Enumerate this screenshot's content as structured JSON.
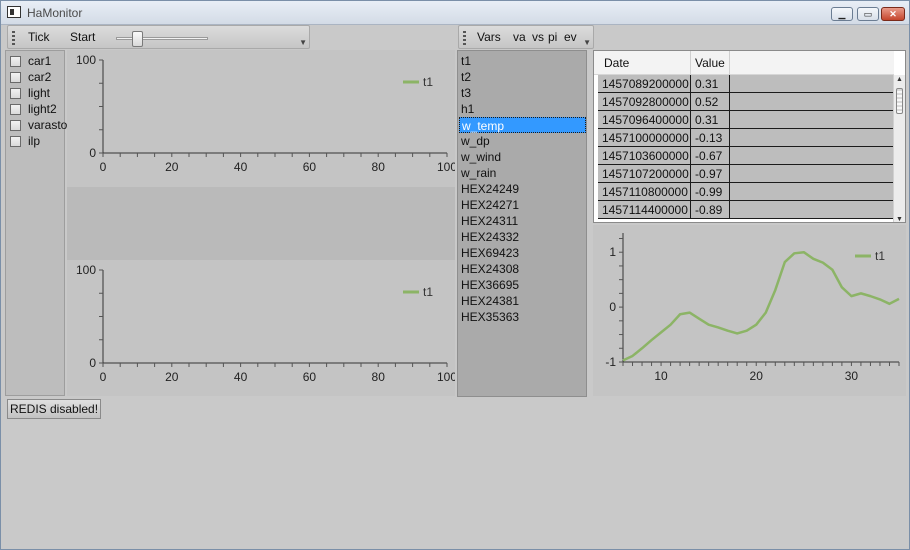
{
  "window": {
    "title": "HaMonitor",
    "controls": [
      "▁",
      "▭",
      "✕"
    ]
  },
  "toolbar1": {
    "items": [
      "Tick",
      "Start"
    ]
  },
  "toolbar2": {
    "items": [
      "Vars",
      "va",
      "vs",
      "pi",
      "ev"
    ]
  },
  "checkboxes": [
    {
      "label": "car1",
      "checked": false
    },
    {
      "label": "car2",
      "checked": false
    },
    {
      "label": "light",
      "checked": false
    },
    {
      "label": "light2",
      "checked": false
    },
    {
      "label": "varasto",
      "checked": false
    },
    {
      "label": "ilp",
      "checked": false
    }
  ],
  "vars": {
    "items": [
      "t1",
      "t2",
      "t3",
      "h1",
      "w_temp",
      "w_dp",
      "w_wind",
      "w_rain",
      "HEX24249",
      "HEX24271",
      "HEX24311",
      "HEX24332",
      "HEX69423",
      "HEX24308",
      "HEX36695",
      "HEX24381",
      "HEX35363"
    ],
    "selected": "w_temp"
  },
  "grid": {
    "columns": [
      "Date",
      "Value"
    ],
    "rows": [
      [
        "1457089200000",
        "0.31"
      ],
      [
        "1457092800000",
        "0.52"
      ],
      [
        "1457096400000",
        "0.31"
      ],
      [
        "1457100000000",
        "-0.13"
      ],
      [
        "1457103600000",
        "-0.67"
      ],
      [
        "1457107200000",
        "-0.97"
      ],
      [
        "1457110800000",
        "-0.99"
      ],
      [
        "1457114400000",
        "-0.89"
      ]
    ]
  },
  "status": {
    "label": "REDIS disabled!"
  },
  "colors": {
    "series": "#8cb466",
    "selection": "#3399ff"
  },
  "chart_data": [
    {
      "type": "line",
      "title": "",
      "xlabel": "",
      "ylabel": "",
      "xlim": [
        0,
        100
      ],
      "ylim": [
        0,
        100
      ],
      "xticks": [
        "0",
        "20",
        "40",
        "60",
        "80",
        "100"
      ],
      "yticks": [
        "0",
        "100"
      ],
      "legend": "top-right",
      "grid": false,
      "series": [
        {
          "name": "t1",
          "x": [],
          "y": []
        }
      ]
    },
    {
      "type": "line",
      "title": "",
      "xlabel": "",
      "ylabel": "",
      "xlim": [
        0,
        100
      ],
      "ylim": [
        0,
        100
      ],
      "xticks": [
        "0",
        "20",
        "40",
        "60",
        "80",
        "100"
      ],
      "yticks": [
        "0",
        "100"
      ],
      "legend": "top-right",
      "grid": false,
      "series": [
        {
          "name": "t1",
          "x": [],
          "y": []
        }
      ]
    },
    {
      "type": "line",
      "title": "",
      "xlabel": "",
      "ylabel": "",
      "xlim": [
        6,
        35
      ],
      "ylim": [
        -1,
        1.35
      ],
      "xticks": [
        "10",
        "20",
        "30"
      ],
      "yticks": [
        "-1",
        "0",
        "1"
      ],
      "legend": "top-right",
      "grid": false,
      "series": [
        {
          "name": "t1",
          "x": [
            6,
            7,
            8,
            9,
            10,
            11,
            12,
            13,
            14,
            15,
            16,
            17,
            18,
            19,
            20,
            21,
            22,
            23,
            24,
            25,
            26,
            27,
            28,
            29,
            30,
            31,
            32,
            33,
            34,
            35
          ],
          "y": [
            -0.97,
            -0.89,
            -0.75,
            -0.6,
            -0.46,
            -0.32,
            -0.13,
            -0.1,
            -0.21,
            -0.32,
            -0.37,
            -0.43,
            -0.48,
            -0.43,
            -0.32,
            -0.1,
            0.31,
            0.82,
            0.98,
            1.0,
            0.88,
            0.81,
            0.68,
            0.36,
            0.2,
            0.25,
            0.2,
            0.14,
            0.06,
            0.15
          ]
        }
      ]
    }
  ]
}
